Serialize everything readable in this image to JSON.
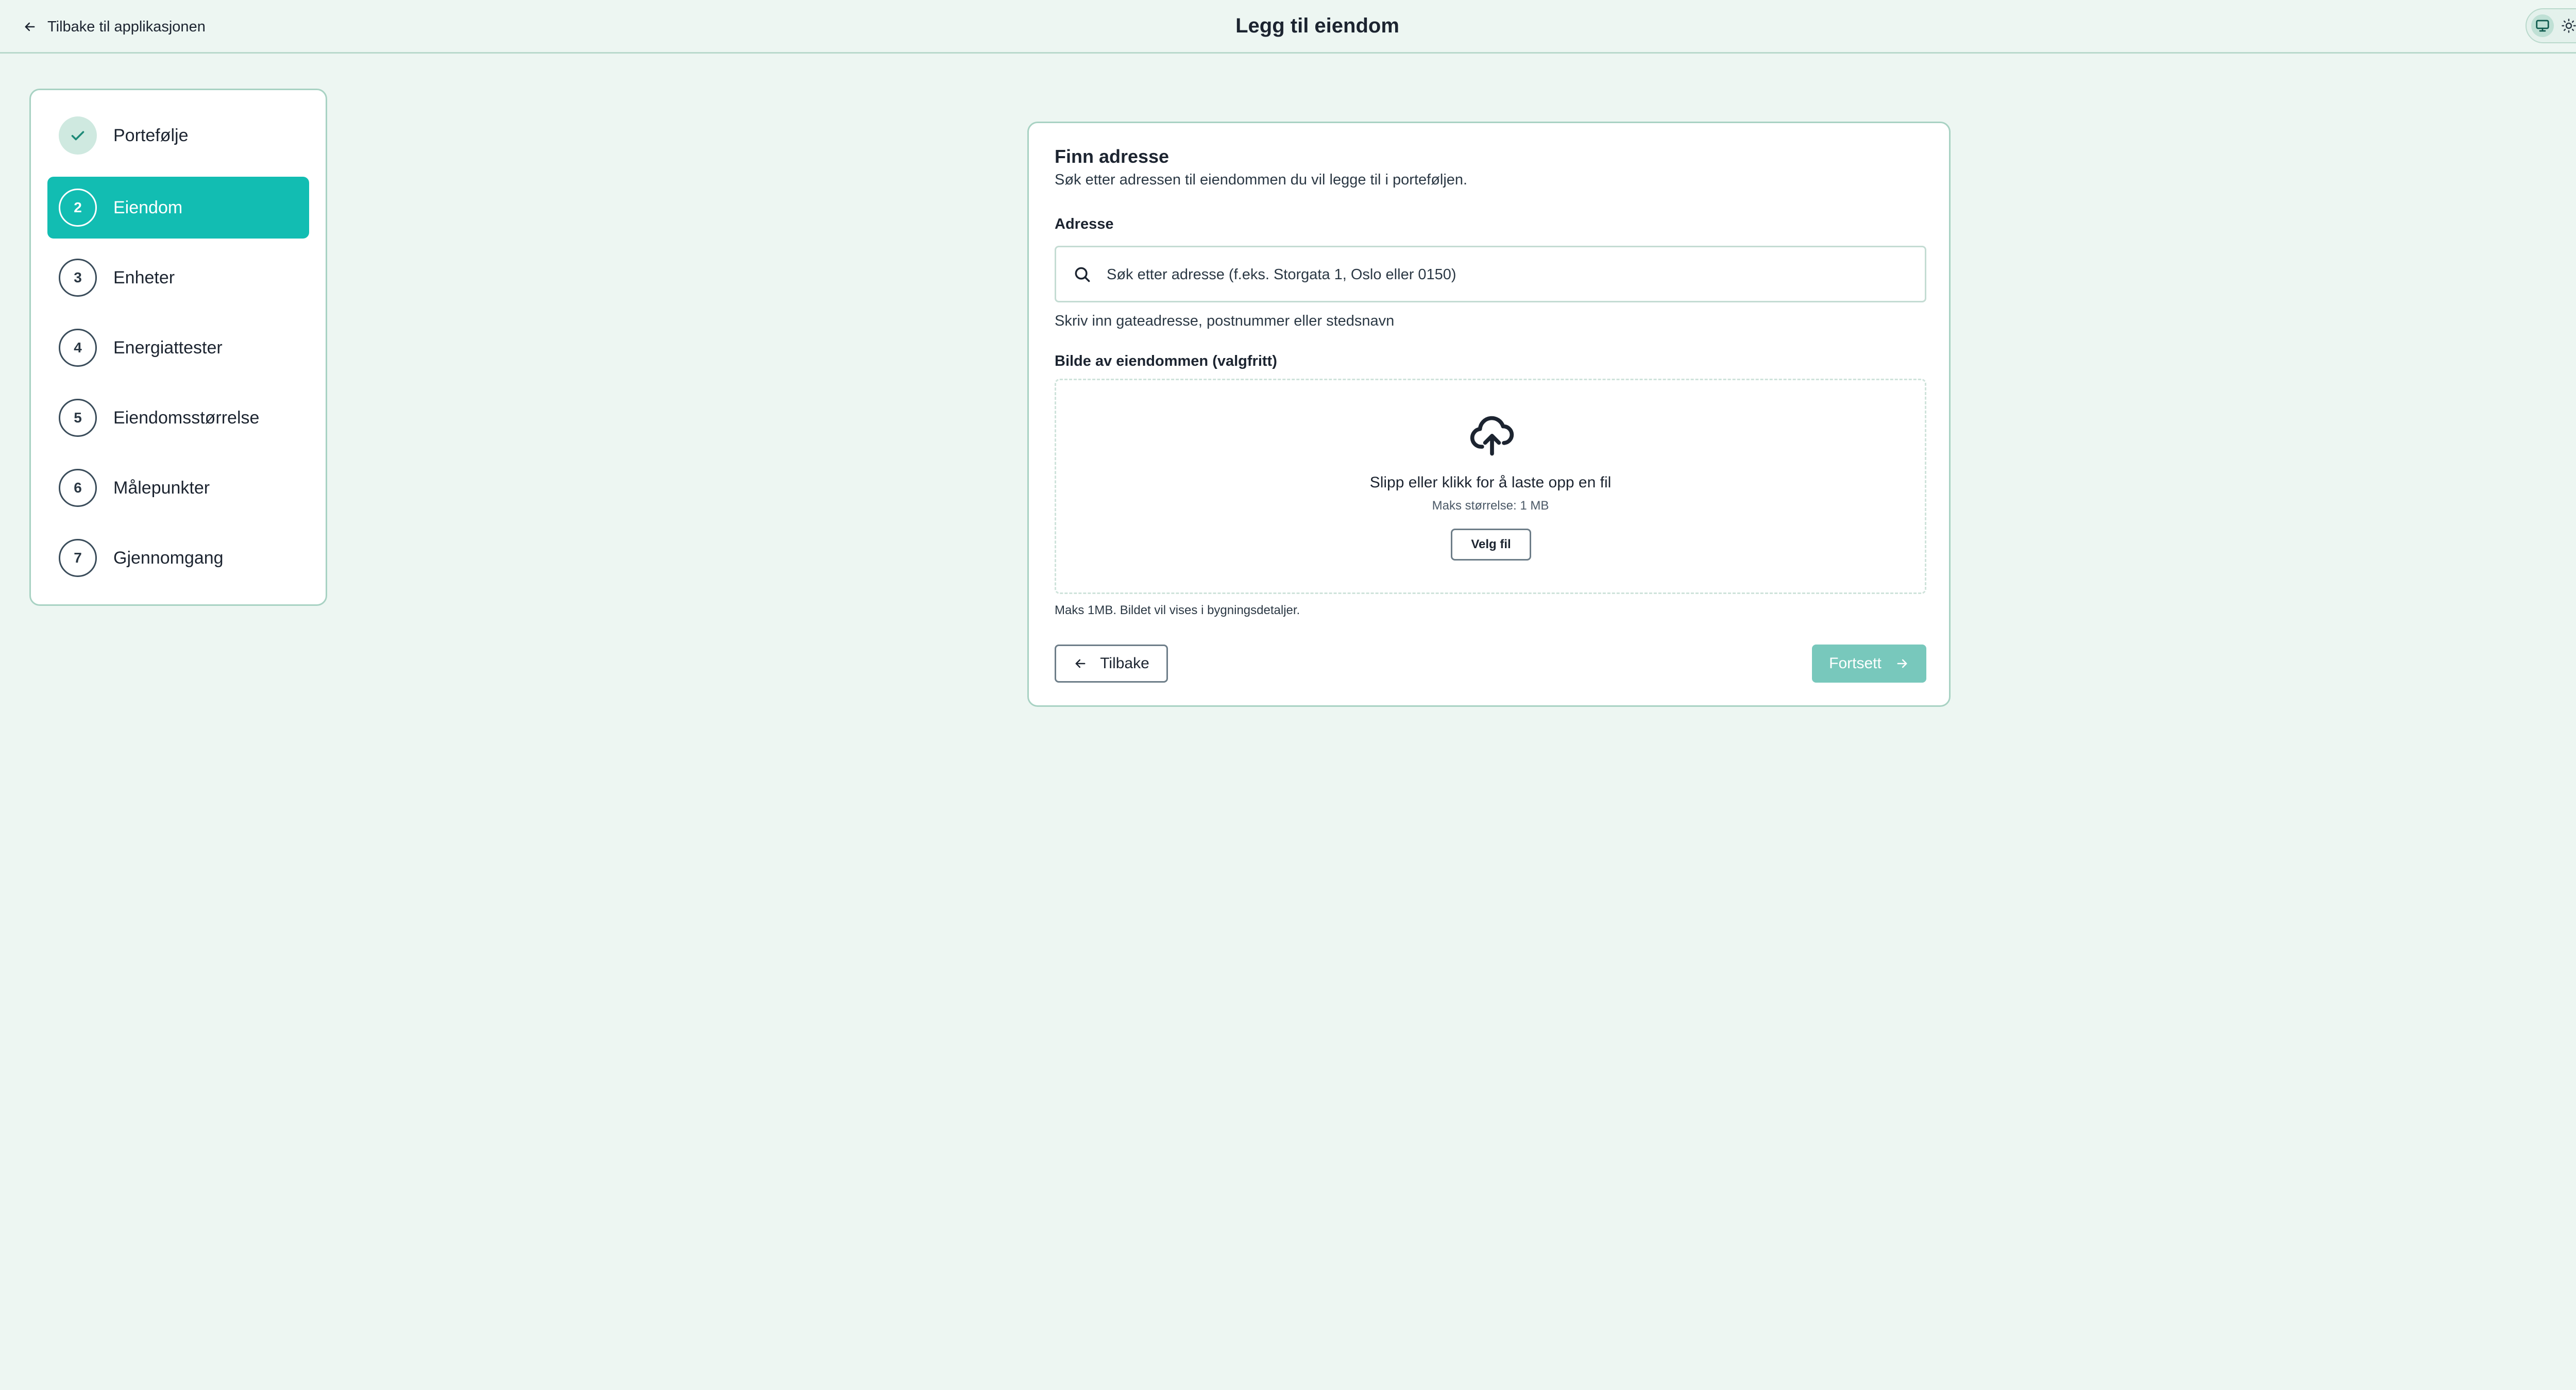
{
  "header": {
    "back_label": "Tilbake til applikasjonen",
    "title": "Legg til eiendom",
    "theme_modes": [
      "system",
      "light",
      "dark"
    ],
    "active_theme": "system"
  },
  "stepper": {
    "steps": [
      {
        "number": "1",
        "label": "Portefølje",
        "state": "completed"
      },
      {
        "number": "2",
        "label": "Eiendom",
        "state": "active"
      },
      {
        "number": "3",
        "label": "Enheter",
        "state": "pending"
      },
      {
        "number": "4",
        "label": "Energiattester",
        "state": "pending"
      },
      {
        "number": "5",
        "label": "Eiendomsstørrelse",
        "state": "pending"
      },
      {
        "number": "6",
        "label": "Målepunkter",
        "state": "pending"
      },
      {
        "number": "7",
        "label": "Gjennomgang",
        "state": "pending"
      }
    ]
  },
  "card": {
    "title": "Finn adresse",
    "description": "Søk etter adressen til eiendommen du vil legge til i porteføljen.",
    "address_label": "Adresse",
    "address_placeholder": "Søk etter adresse (f.eks. Storgata 1, Oslo eller 0150)",
    "address_value": "",
    "address_help": "Skriv inn gateadresse, postnummer eller stedsnavn",
    "image_label": "Bilde av eiendommen (valgfritt)",
    "dropzone_text": "Slipp eller klikk for å laste opp en fil",
    "dropzone_size": "Maks størrelse: 1 MB",
    "choose_file_label": "Velg fil",
    "image_note": "Maks 1MB. Bildet vil vises i bygningsdetaljer.",
    "back_button": "Tilbake",
    "continue_button": "Fortsett"
  },
  "colors": {
    "background": "#edf6f2",
    "accent": "#12bdb2",
    "border": "#a8d2c3",
    "continue_disabled": "#78c8bc"
  }
}
